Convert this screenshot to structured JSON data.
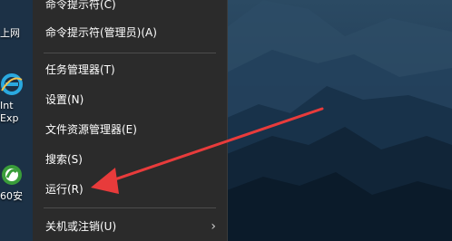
{
  "desktop": {
    "icons": [
      {
        "label": "上网"
      },
      {
        "label": "Int\nExp"
      },
      {
        "label": "60安"
      }
    ]
  },
  "menu": {
    "items": [
      {
        "label": "命令提示符(C)"
      },
      {
        "label": "命令提示符(管理员)(A)"
      },
      {
        "label": "任务管理器(T)"
      },
      {
        "label": "设置(N)"
      },
      {
        "label": "文件资源管理器(E)"
      },
      {
        "label": "搜索(S)"
      },
      {
        "label": "运行(R)"
      },
      {
        "label": "关机或注销(U)"
      }
    ],
    "submenu_arrow": "›"
  },
  "annotation": {
    "arrow_color": "#e83b3b"
  }
}
